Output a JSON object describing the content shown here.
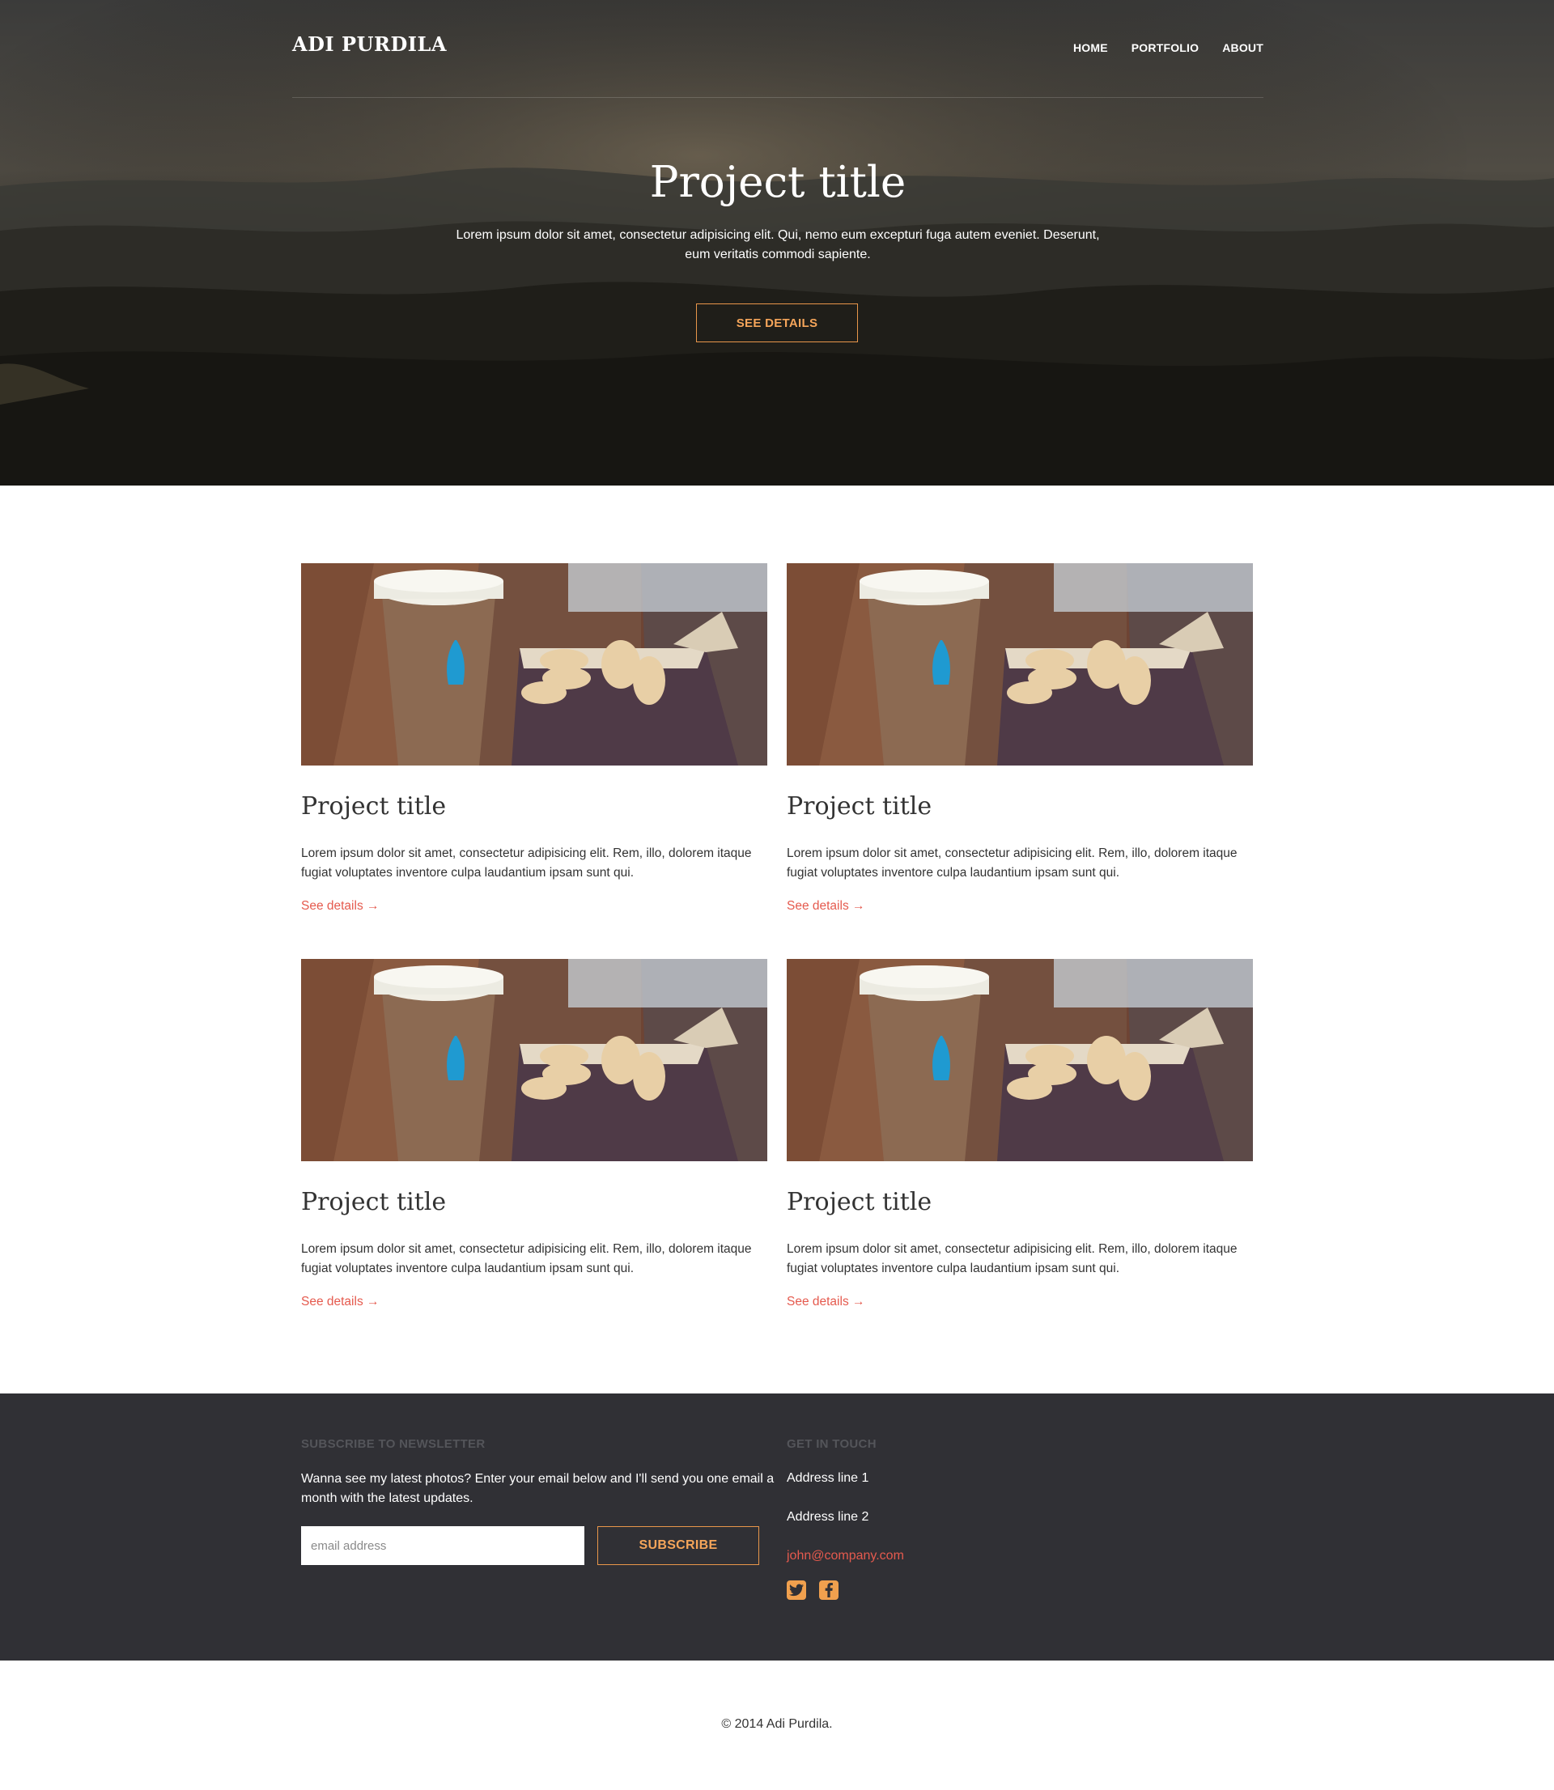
{
  "header": {
    "brand": "ADI PURDILA",
    "nav": [
      {
        "label": "HOME"
      },
      {
        "label": "PORTFOLIO"
      },
      {
        "label": "ABOUT"
      }
    ]
  },
  "hero": {
    "title": "Project title",
    "description": "Lorem ipsum dolor sit amet, consectetur adipisicing elit. Qui, nemo eum excepturi fuga autem eveniet. Deserunt, eum veritatis commodi sapiente.",
    "button_label": "SEE DETAILS"
  },
  "projects": [
    {
      "title": "Project title",
      "text": "Lorem ipsum dolor sit amet, consectetur adipisicing elit. Rem, illo, dolorem itaque fugiat voluptates inventore culpa laudantium ipsam sunt qui.",
      "link": "See details →"
    },
    {
      "title": "Project title",
      "text": "Lorem ipsum dolor sit amet, consectetur adipisicing elit. Rem, illo, dolorem itaque fugiat voluptates inventore culpa laudantium ipsam sunt qui.",
      "link": "See details →"
    },
    {
      "title": "Project title",
      "text": "Lorem ipsum dolor sit amet, consectetur adipisicing elit. Rem, illo, dolorem itaque fugiat voluptates inventore culpa laudantium ipsam sunt qui.",
      "link": "See details →"
    },
    {
      "title": "Project title",
      "text": "Lorem ipsum dolor sit amet, consectetur adipisicing elit. Rem, illo, dolorem itaque fugiat voluptates inventore culpa laudantium ipsam sunt qui.",
      "link": "See details →"
    }
  ],
  "footer": {
    "newsletter": {
      "heading": "SUBSCRIBE TO NEWSLETTER",
      "text": "Wanna see my latest photos? Enter your email below and I'll send you one email a month with the latest updates.",
      "input_placeholder": "email address",
      "input_value": "",
      "button_label": "SUBSCRIBE"
    },
    "contact": {
      "heading": "GET IN TOUCH",
      "address_1": "Address line 1",
      "address_2": "Address line 2",
      "email": "john@company.com",
      "social_icons": [
        "twitter-icon",
        "facebook-icon"
      ]
    }
  },
  "copyright": "© 2014 Adi Purdila.",
  "colors": {
    "accent_orange": "#f0a04e",
    "link_red": "#e55a4e",
    "footer_bg": "#303035",
    "hero_overlay": "#1d1b17"
  }
}
